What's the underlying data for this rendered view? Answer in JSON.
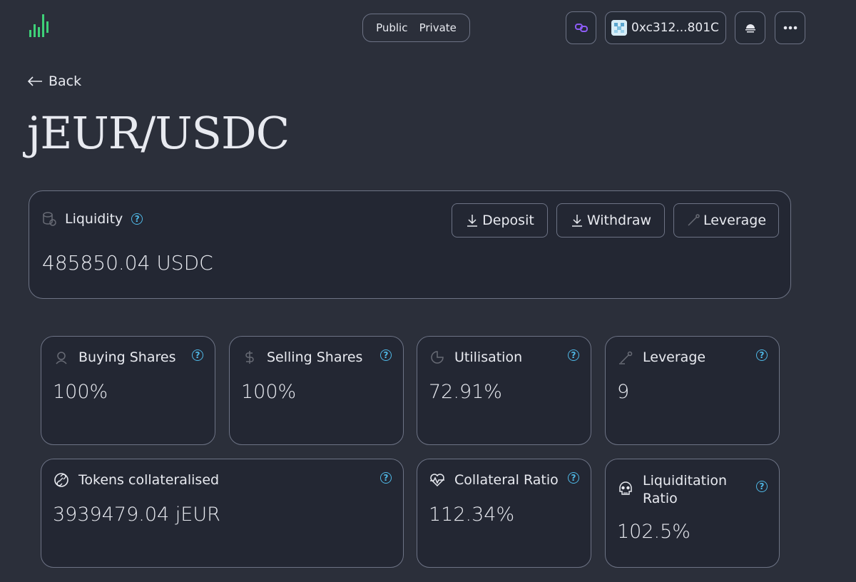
{
  "header": {
    "visibility_toggle": {
      "public_label": "Public",
      "private_label": "Private"
    },
    "chain_icon": "polygon-icon",
    "wallet_address": "0xc312...801C",
    "theme_icon": "sunset-icon",
    "more_icon": "ellipsis-icon"
  },
  "nav": {
    "back_label": "Back"
  },
  "page": {
    "title": "jEUR/USDC"
  },
  "liquidity": {
    "label": "Liquidity",
    "value": "485850.04 USDC",
    "actions": {
      "deposit_label": "Deposit",
      "withdraw_label": "Withdraw",
      "leverage_label": "Leverage"
    }
  },
  "stats": {
    "buying_shares": {
      "label": "Buying Shares",
      "value": "100%"
    },
    "selling_shares": {
      "label": "Selling Shares",
      "value": "100%"
    },
    "utilisation": {
      "label": "Utilisation",
      "value": "72.91%"
    },
    "leverage": {
      "label": "Leverage",
      "value": "9"
    },
    "tokens_collateralised": {
      "label": "Tokens collateralised",
      "value": "3939479.04 jEUR"
    },
    "collateral_ratio": {
      "label": "Collateral Ratio",
      "value": "112.34%"
    },
    "liquidation_ratio": {
      "label_line1": "Liquiditation",
      "label_line2": "Ratio",
      "value": "102.5%"
    }
  },
  "colors": {
    "background": "#2b2f3a",
    "card": "#232733",
    "border": "#6d7385",
    "accent_help": "#4fb8e6",
    "logo_green": "#3ed178",
    "chain_purple": "#8d5cf6"
  }
}
